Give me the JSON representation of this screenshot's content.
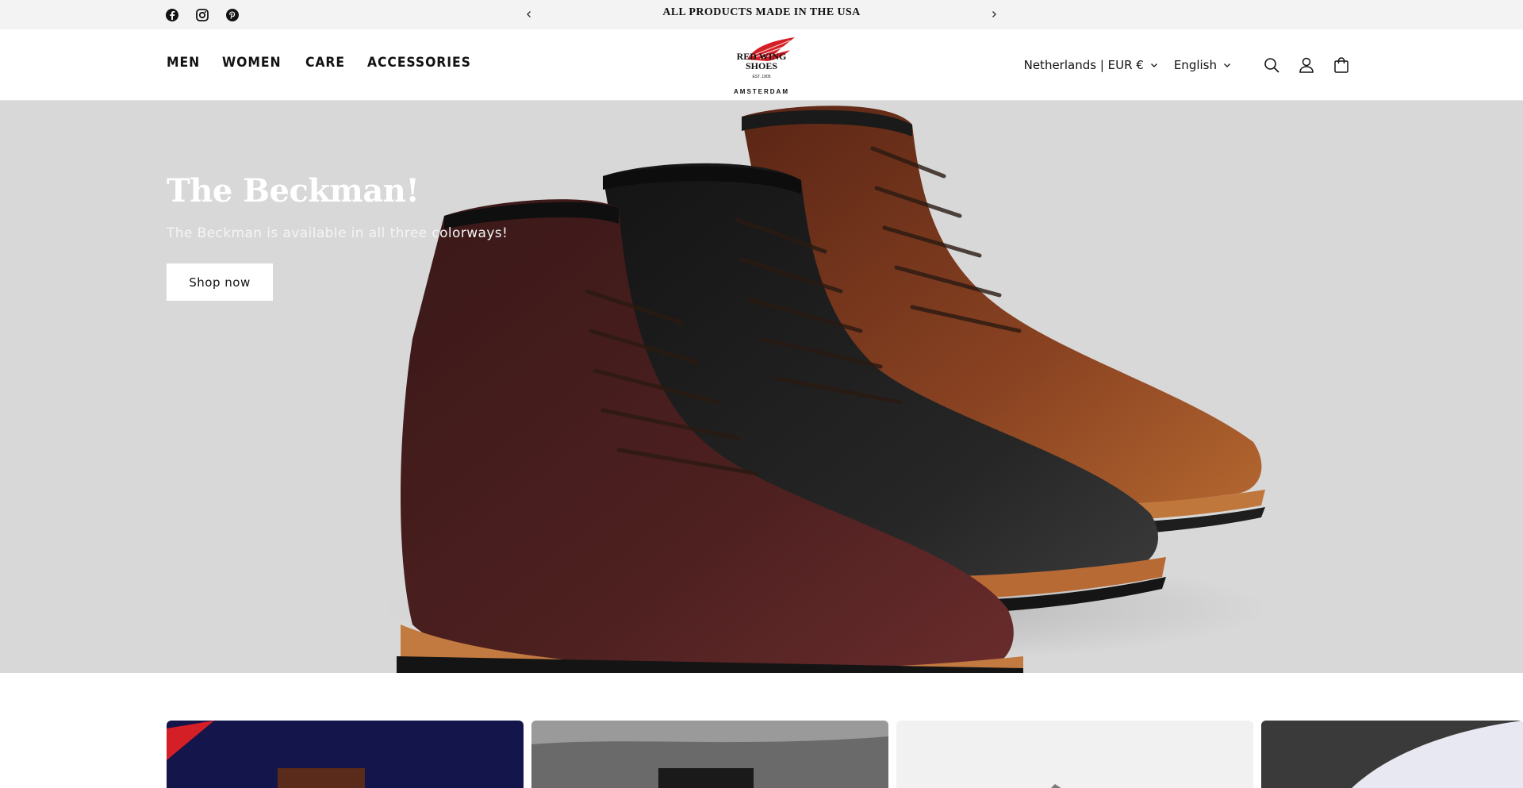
{
  "announcement": {
    "text": "ALL PRODUCTS MADE IN THE USA",
    "prev_icon": "chevron-left-icon",
    "next_icon": "chevron-right-icon"
  },
  "social": [
    "facebook-icon",
    "instagram-icon",
    "pinterest-icon"
  ],
  "nav": {
    "items": [
      "MEN",
      "WOMEN",
      "CARE",
      "ACCESSORIES"
    ]
  },
  "logo": {
    "line1": "RED WING",
    "line2": "SHOES",
    "est": "EST. 1905",
    "location": "AMSTERDAM"
  },
  "header": {
    "country": "Netherlands | EUR €",
    "language": "English",
    "icons": [
      "search-icon",
      "account-icon",
      "cart-icon"
    ]
  },
  "hero": {
    "title": "The Beckman!",
    "subtitle": "The Beckman is available in all three colorways!",
    "button": "Shop now"
  },
  "colors": {
    "announcement_bg": "#f3f3f3",
    "hero_bg": "#d8d8d8",
    "boot_oxblood": "#4a1f1f",
    "boot_black": "#1c1c1c",
    "boot_brown": "#7a3a1e",
    "sole": "#b86a35"
  }
}
